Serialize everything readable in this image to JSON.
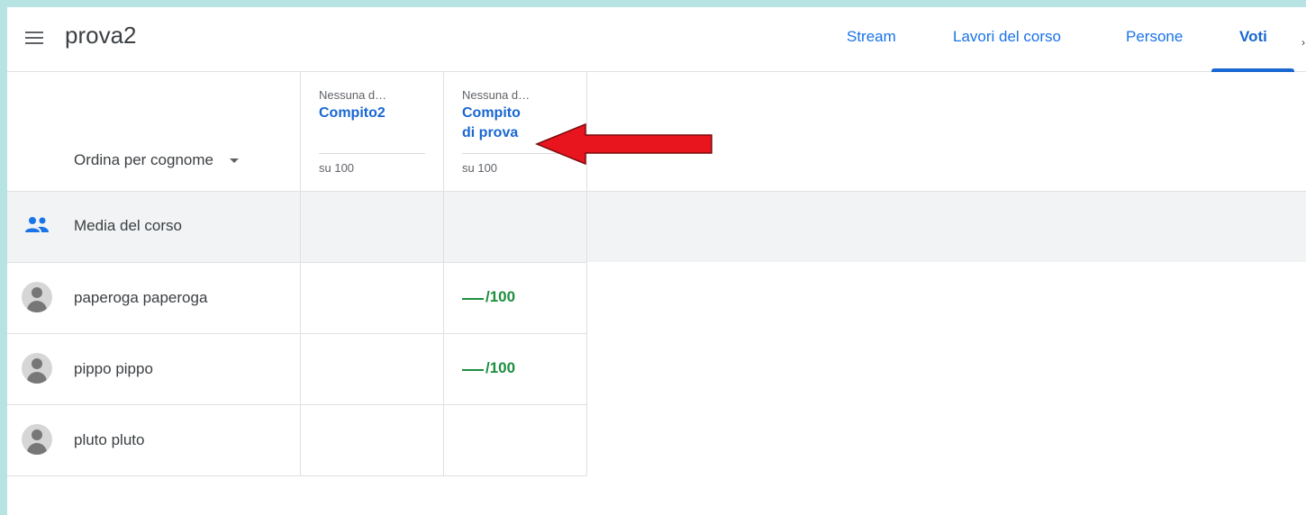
{
  "header": {
    "class_name": "prova2",
    "tabs": [
      {
        "label": "Stream"
      },
      {
        "label": "Lavori del corso"
      },
      {
        "label": "Persone"
      },
      {
        "label": "Voti"
      }
    ],
    "active_tab": "Voti"
  },
  "gradebook": {
    "sort_label": "Ordina per cognome",
    "assignments": [
      {
        "due": "Nessuna d…",
        "title": "Compito2",
        "points": "su 100"
      },
      {
        "due": "Nessuna d…",
        "title_line1": "Compito",
        "title_line2": "di prova",
        "points": "su 100"
      }
    ],
    "class_average_label": "Media del corso",
    "students": [
      {
        "name": "paperoga paperoga",
        "grades": [
          "",
          "/100"
        ]
      },
      {
        "name": "pippo pippo",
        "grades": [
          "",
          "/100"
        ]
      },
      {
        "name": "pluto pluto",
        "grades": [
          "",
          ""
        ]
      }
    ]
  },
  "colors": {
    "accent": "#1967d2",
    "grade_green": "#1e8e3e",
    "annotation_arrow": "#e8151f",
    "frame": "#b7e4e3"
  },
  "annotation": {
    "icon": "red-arrow-pointing-left"
  }
}
